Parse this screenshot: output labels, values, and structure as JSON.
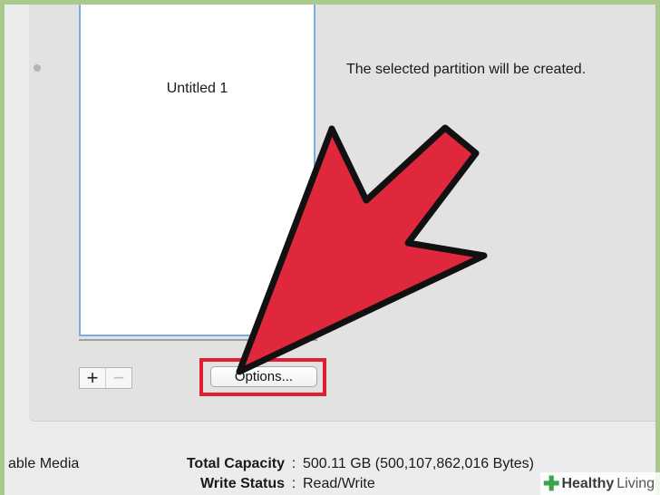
{
  "partition_map": {
    "partition_name": "Untitled 1"
  },
  "info": {
    "message": "The selected partition will be created."
  },
  "buttons": {
    "add": "+",
    "remove": "−",
    "options": "Options..."
  },
  "footer": {
    "media_partial": "able Media",
    "capacity_label": "Total Capacity",
    "capacity_value": "500.11 GB (500,107,862,016 Bytes)",
    "write_label": "Write Status",
    "write_value": "Read/Write",
    "separator": ":"
  },
  "watermark": {
    "brand": "Healthy",
    "brand_suffix": "Living"
  },
  "colors": {
    "arrow": "#e0283c",
    "highlight": "#e01e2f",
    "selection_border": "#7fa9e2"
  }
}
